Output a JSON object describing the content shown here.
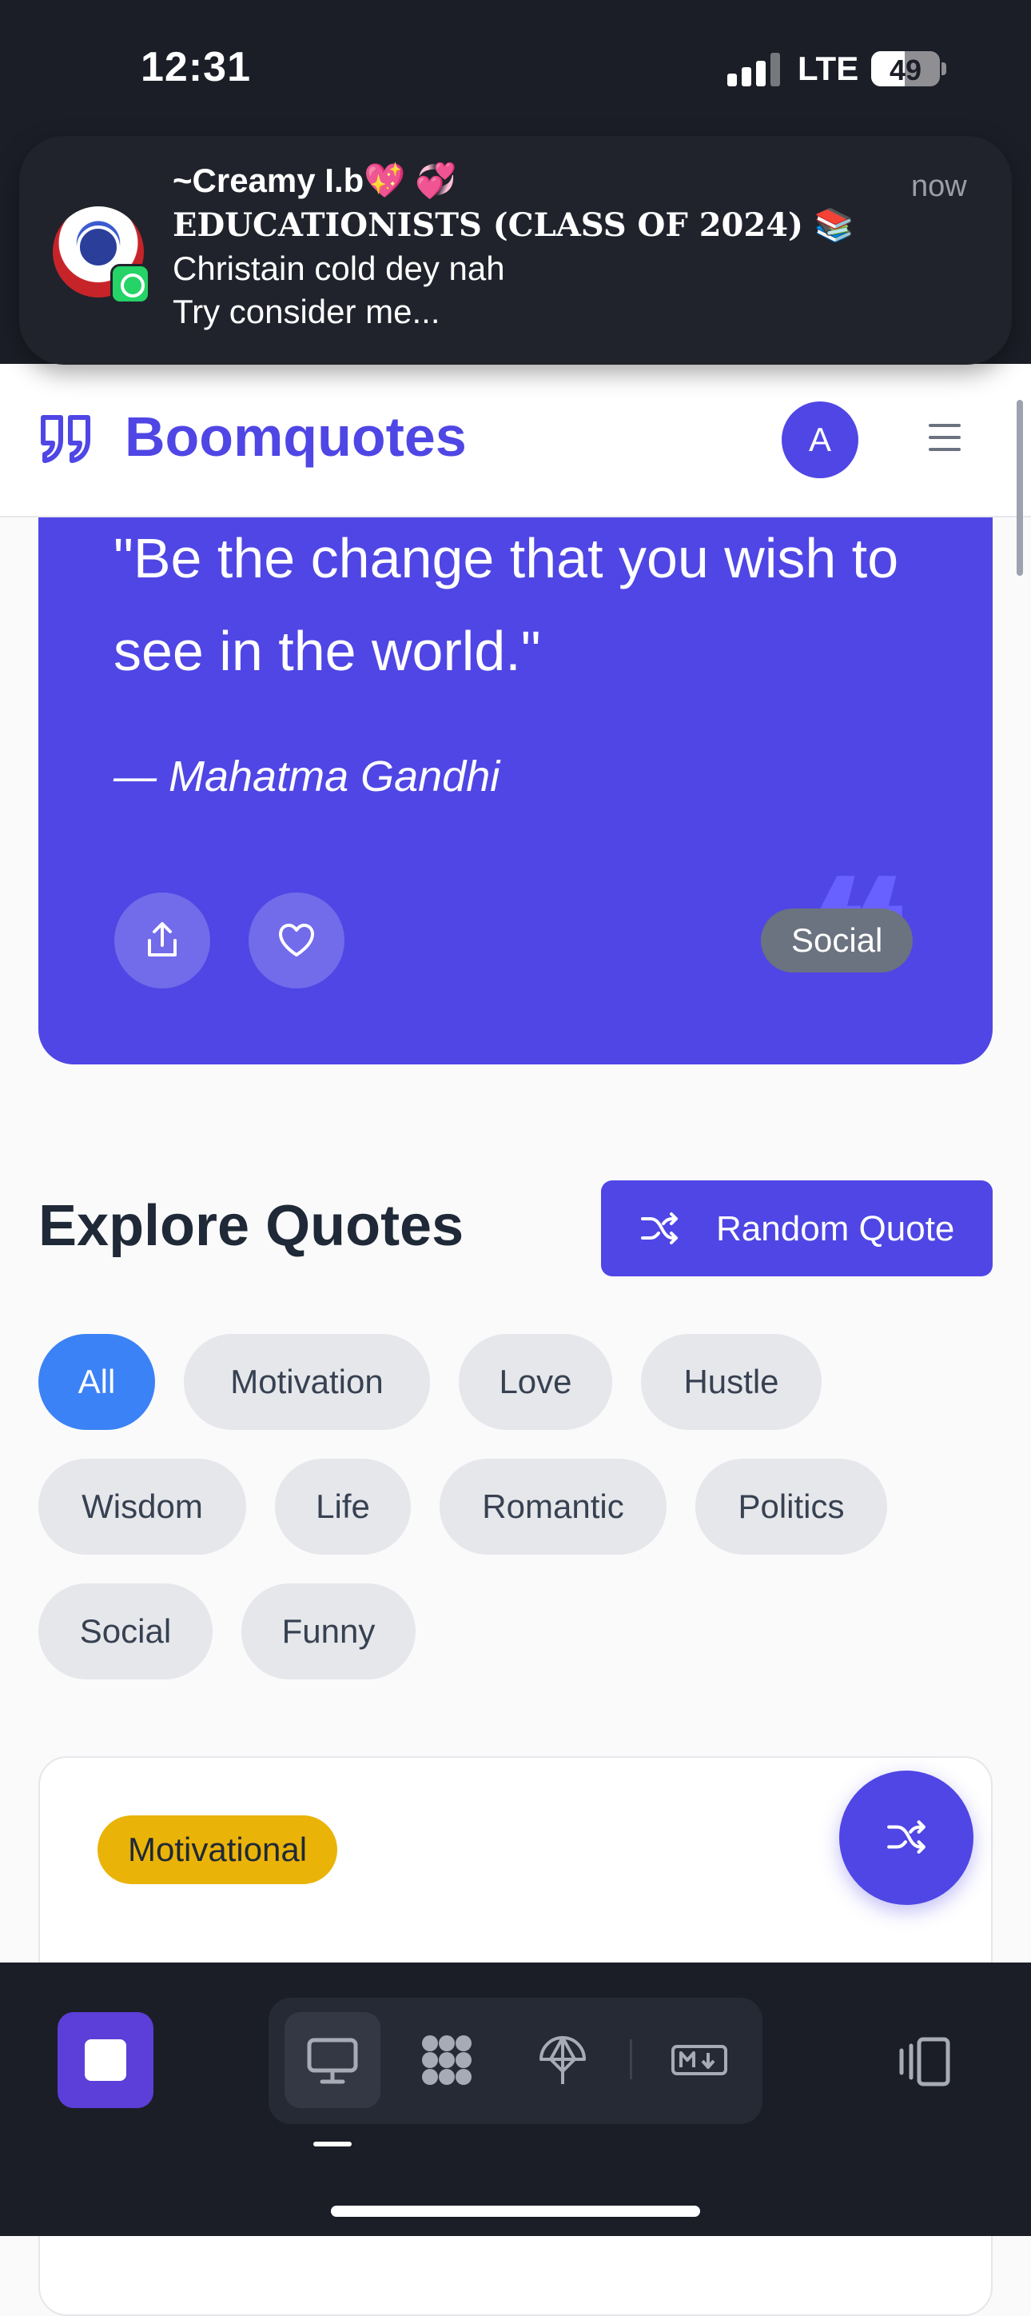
{
  "status_bar": {
    "time": "12:31",
    "network": "LTE",
    "battery": "49",
    "battery_level": 0.49
  },
  "notification": {
    "sender": "~Creamy I.b💖 💞",
    "group": "EDUCATIONISTS (CLASS OF 2024) 📚",
    "line1": "Christain cold dey nah",
    "line2": "Try consider me...",
    "time": "now",
    "app_icon": "whatsapp-icon"
  },
  "header": {
    "brand": "Boomquotes",
    "avatar_initial": "A",
    "menu_icon": "hamburger-menu-icon"
  },
  "featured_quote": {
    "text": "\"Be the change that you wish to see in the world.\"",
    "author": "— Mahatma Gandhi",
    "tag": "Social",
    "share_icon": "share-icon",
    "like_icon": "heart-icon"
  },
  "explore": {
    "title": "Explore Quotes",
    "random_button": "Random Quote",
    "categories": [
      "All",
      "Motivation",
      "Love",
      "Hustle",
      "Wisdom",
      "Life",
      "Romantic",
      "Politics",
      "Social",
      "Funny"
    ],
    "active_category": "All"
  },
  "quote_card": {
    "tag": "Motivational"
  },
  "toolbar": {
    "tools": [
      "desktop-icon",
      "apps-grid-icon",
      "network-icon",
      "markdown-icon"
    ],
    "right_icon": "device-rotate-icon"
  },
  "colors": {
    "accent": "#4f46e5",
    "active_chip": "#3b82f6",
    "tag_yellow": "#eab308",
    "dark_bg": "#1b1e27"
  }
}
